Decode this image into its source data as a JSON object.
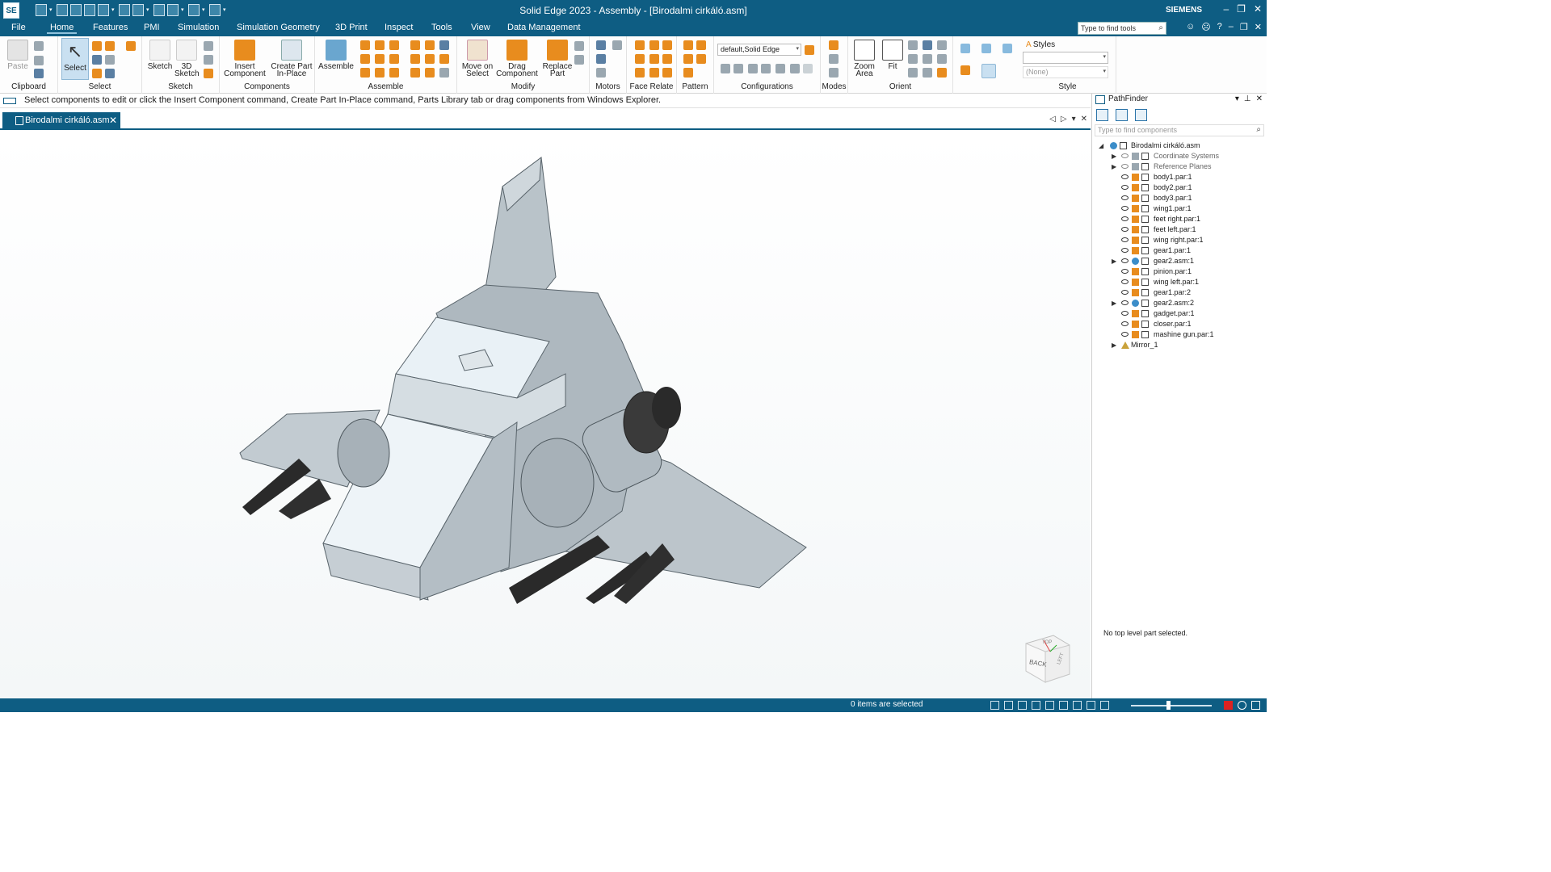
{
  "app": {
    "logo": "SE",
    "title": "Solid Edge 2023 - Assembly - [Birodalmi cirkáló.asm]",
    "brand": "SIEMENS"
  },
  "menu": {
    "tabs": [
      "File",
      "Home",
      "Features",
      "PMI",
      "Simulation",
      "Simulation Geometry",
      "3D Print",
      "Inspect",
      "Tools",
      "View",
      "Data Management"
    ],
    "active": "Home",
    "search_placeholder": "Type to find tools"
  },
  "ribbon": {
    "groups": {
      "clipboard": "Clipboard",
      "select": "Select",
      "sketch": "Sketch",
      "components": "Components",
      "assemble": "Assemble",
      "modify": "Modify",
      "motors": "Motors",
      "face_relate": "Face Relate",
      "pattern": "Pattern",
      "configurations": "Configurations",
      "modes": "Modes",
      "orient": "Orient",
      "style": "Style"
    },
    "buttons": {
      "paste": "Paste",
      "select": "Select",
      "sketch": "Sketch",
      "sketch3d_1": "3D",
      "sketch3d_2": "Sketch",
      "insert_1": "Insert",
      "insert_2": "Component",
      "create_1": "Create Part",
      "create_2": "In-Place",
      "assemble": "Assemble",
      "move_1": "Move on",
      "move_2": "Select",
      "drag_1": "Drag",
      "drag_2": "Component",
      "replace_1": "Replace",
      "replace_2": "Part",
      "zoom_1": "Zoom",
      "zoom_2": "Area",
      "fit": "Fit",
      "styles": "Styles"
    },
    "config_value": "default,Solid Edge",
    "style_value": "",
    "style_none": "(None)"
  },
  "prompt": "Select components to edit or click the Insert Component command, Create Part In-Place command, Parts Library tab or drag components from Windows Explorer.",
  "doc_tab": "Birodalmi cirkáló.asm",
  "viewcube": {
    "face1": "BACK",
    "face2": "LEFT",
    "face3": "TOP"
  },
  "pathfinder": {
    "title": "PathFinder",
    "search_placeholder": "Type to find components",
    "root": "Birodalmi cirkáló.asm",
    "items": [
      {
        "label": "Coordinate Systems",
        "expandable": true,
        "muted": true,
        "kind": "coord"
      },
      {
        "label": "Reference Planes",
        "expandable": true,
        "muted": true,
        "kind": "plane"
      },
      {
        "label": "body1.par:1",
        "expandable": false,
        "muted": false,
        "kind": "part"
      },
      {
        "label": "body2.par:1",
        "expandable": false,
        "muted": false,
        "kind": "part"
      },
      {
        "label": "body3.par:1",
        "expandable": false,
        "muted": false,
        "kind": "part"
      },
      {
        "label": "wing1.par:1",
        "expandable": false,
        "muted": false,
        "kind": "part"
      },
      {
        "label": "feet right.par:1",
        "expandable": false,
        "muted": false,
        "kind": "part"
      },
      {
        "label": "feet left.par:1",
        "expandable": false,
        "muted": false,
        "kind": "part"
      },
      {
        "label": "wing right.par:1",
        "expandable": false,
        "muted": false,
        "kind": "part"
      },
      {
        "label": "gear1.par:1",
        "expandable": false,
        "muted": false,
        "kind": "part"
      },
      {
        "label": "gear2.asm:1",
        "expandable": true,
        "muted": false,
        "kind": "asm"
      },
      {
        "label": "pinion.par:1",
        "expandable": false,
        "muted": false,
        "kind": "part"
      },
      {
        "label": "wing left.par:1",
        "expandable": false,
        "muted": false,
        "kind": "part"
      },
      {
        "label": "gear1.par:2",
        "expandable": false,
        "muted": false,
        "kind": "part"
      },
      {
        "label": "gear2.asm:2",
        "expandable": true,
        "muted": false,
        "kind": "asm"
      },
      {
        "label": "gadget.par:1",
        "expandable": false,
        "muted": false,
        "kind": "part"
      },
      {
        "label": "closer.par:1",
        "expandable": false,
        "muted": false,
        "kind": "part"
      },
      {
        "label": "mashine gun.par:1",
        "expandable": false,
        "muted": false,
        "kind": "part"
      },
      {
        "label": "Mirror_1",
        "expandable": true,
        "muted": false,
        "kind": "mirror"
      }
    ],
    "no_selection": "No top level part selected."
  },
  "status": {
    "selected": "0 items are selected"
  },
  "colors": {
    "accent": "#0e5d83",
    "part_icon": "#e88c1e",
    "model_gray": "#b9c3c9",
    "model_dark": "#2a2a2a"
  }
}
